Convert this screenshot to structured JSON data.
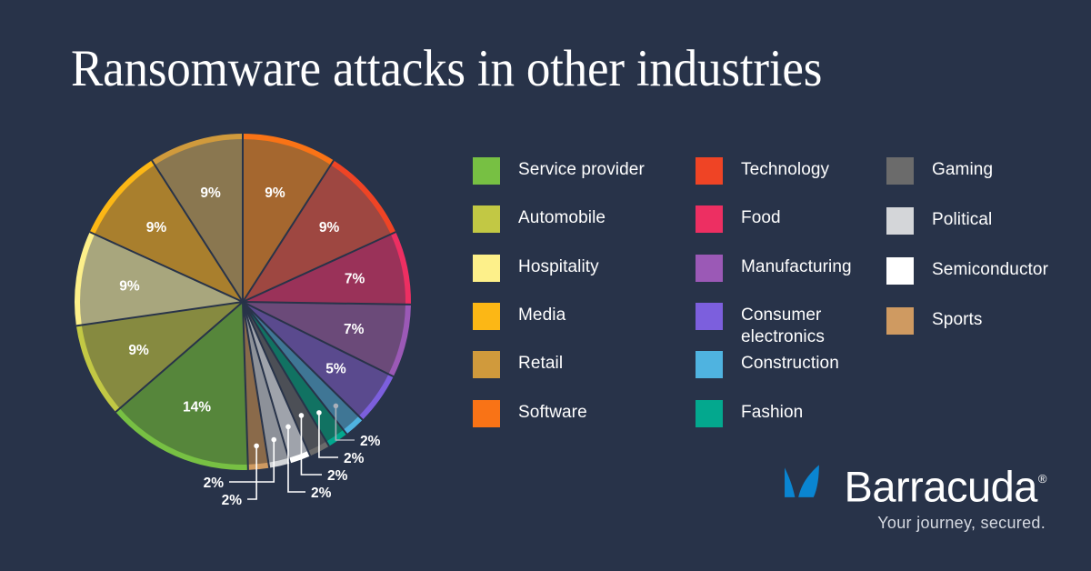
{
  "page": {
    "title": "Ransomware attacks in other industries",
    "background_color": "#283349",
    "text_color": "#ffffff"
  },
  "chart_data": {
    "type": "pie",
    "title": "Ransomware attacks in other industries",
    "unit": "%",
    "legend_position": "right",
    "start_angle_deg": 0,
    "direction": "clockwise",
    "categories": [
      "Software",
      "Technology",
      "Food",
      "Manufacturing",
      "Consumer electronics",
      "Construction",
      "Fashion",
      "Gaming",
      "Semiconductor",
      "Political",
      "Sports",
      "Service provider",
      "Automobile",
      "Hospitality",
      "Media",
      "Retail"
    ],
    "values": [
      9,
      9,
      7,
      7,
      5,
      2,
      2,
      2,
      2,
      2,
      2,
      14,
      9,
      9,
      9,
      9
    ],
    "labels": [
      "9%",
      "9%",
      "7%",
      "7%",
      "5%",
      "2%",
      "2%",
      "2%",
      "2%",
      "2%",
      "2%",
      "14%",
      "9%",
      "9%",
      "9%",
      "9%"
    ],
    "colors": [
      "#f97316",
      "#ef4425",
      "#ed2f62",
      "#9b59b6",
      "#7c5fdd",
      "#4fb3e0",
      "#03a88e",
      "#6b6b6b",
      "#ffffff",
      "#d4d6d9",
      "#cf9a61",
      "#77c043",
      "#c2c844",
      "#fdf08a",
      "#fcb715",
      "#d09a3c"
    ],
    "slices": [
      {
        "name": "Software",
        "value": 9,
        "label": "9%",
        "color": "#f97316",
        "fill": "#a5672f",
        "callout": false
      },
      {
        "name": "Technology",
        "value": 9,
        "label": "9%",
        "color": "#ef4425",
        "fill": "#9e4741",
        "callout": false
      },
      {
        "name": "Food",
        "value": 7,
        "label": "7%",
        "color": "#ed2f62",
        "fill": "#9a3259",
        "callout": false
      },
      {
        "name": "Manufacturing",
        "value": 7,
        "label": "7%",
        "color": "#9b59b6",
        "fill": "#6b4a79",
        "callout": false
      },
      {
        "name": "Consumer electronics",
        "value": 5,
        "label": "5%",
        "color": "#7c5fdd",
        "fill": "#5a4a8e",
        "callout": false
      },
      {
        "name": "Construction",
        "value": 2,
        "label": "2%",
        "color": "#4fb3e0",
        "fill": "#3f7695",
        "callout": true
      },
      {
        "name": "Fashion",
        "value": 2,
        "label": "2%",
        "color": "#03a88e",
        "fill": "#117262",
        "callout": true
      },
      {
        "name": "Gaming",
        "value": 2,
        "label": "2%",
        "color": "#6b6b6b",
        "fill": "#4c4f56",
        "callout": true
      },
      {
        "name": "Semiconductor",
        "value": 2,
        "label": "2%",
        "color": "#ffffff",
        "fill": "#9fa3ab",
        "callout": true
      },
      {
        "name": "Political",
        "value": 2,
        "label": "2%",
        "color": "#d4d6d9",
        "fill": "#8d9199",
        "callout": true
      },
      {
        "name": "Sports",
        "value": 2,
        "label": "2%",
        "color": "#cf9a61",
        "fill": "#8a6a4a",
        "callout": true
      },
      {
        "name": "Service provider",
        "value": 14,
        "label": "14%",
        "color": "#77c043",
        "fill": "#56863b",
        "callout": false
      },
      {
        "name": "Automobile",
        "value": 9,
        "label": "9%",
        "color": "#c2c844",
        "fill": "#868a40",
        "callout": false
      },
      {
        "name": "Hospitality",
        "value": 9,
        "label": "9%",
        "color": "#fdf08a",
        "fill": "#a8a67d",
        "callout": false
      },
      {
        "name": "Media",
        "value": 9,
        "label": "9%",
        "color": "#fcb715",
        "fill": "#a97f2d",
        "callout": false
      },
      {
        "name": "Retail",
        "value": 9,
        "label": "9%",
        "color": "#d09a3c",
        "fill": "#8a7750",
        "callout": false
      }
    ]
  },
  "legend": {
    "columns": [
      {
        "items": [
          {
            "label": "Service provider",
            "color": "#77c043"
          },
          {
            "label": "Automobile",
            "color": "#c2c844"
          },
          {
            "label": "Hospitality",
            "color": "#fdf08a"
          },
          {
            "label": "Media",
            "color": "#fcb715"
          },
          {
            "label": "Retail",
            "color": "#d09a3c"
          },
          {
            "label": "Software",
            "color": "#f97316"
          }
        ]
      },
      {
        "items": [
          {
            "label": "Technology",
            "color": "#ef4425"
          },
          {
            "label": "Food",
            "color": "#ed2f62"
          },
          {
            "label": "Manufacturing",
            "color": "#9b59b6"
          },
          {
            "label": "Consumer electronics",
            "color": "#7c5fdd"
          },
          {
            "label": "Construction",
            "color": "#4fb3e0"
          },
          {
            "label": "Fashion",
            "color": "#03a88e"
          }
        ]
      },
      {
        "items": [
          {
            "label": "Gaming",
            "color": "#6b6b6b"
          },
          {
            "label": "Political",
            "color": "#d4d6d9"
          },
          {
            "label": "Semiconductor",
            "color": "#ffffff"
          },
          {
            "label": "Sports",
            "color": "#cf9a61"
          }
        ]
      }
    ]
  },
  "logo": {
    "wordmark": "Barracuda",
    "registered": "®",
    "tagline": "Your journey, secured.",
    "fin_color": "#0a85d1"
  }
}
